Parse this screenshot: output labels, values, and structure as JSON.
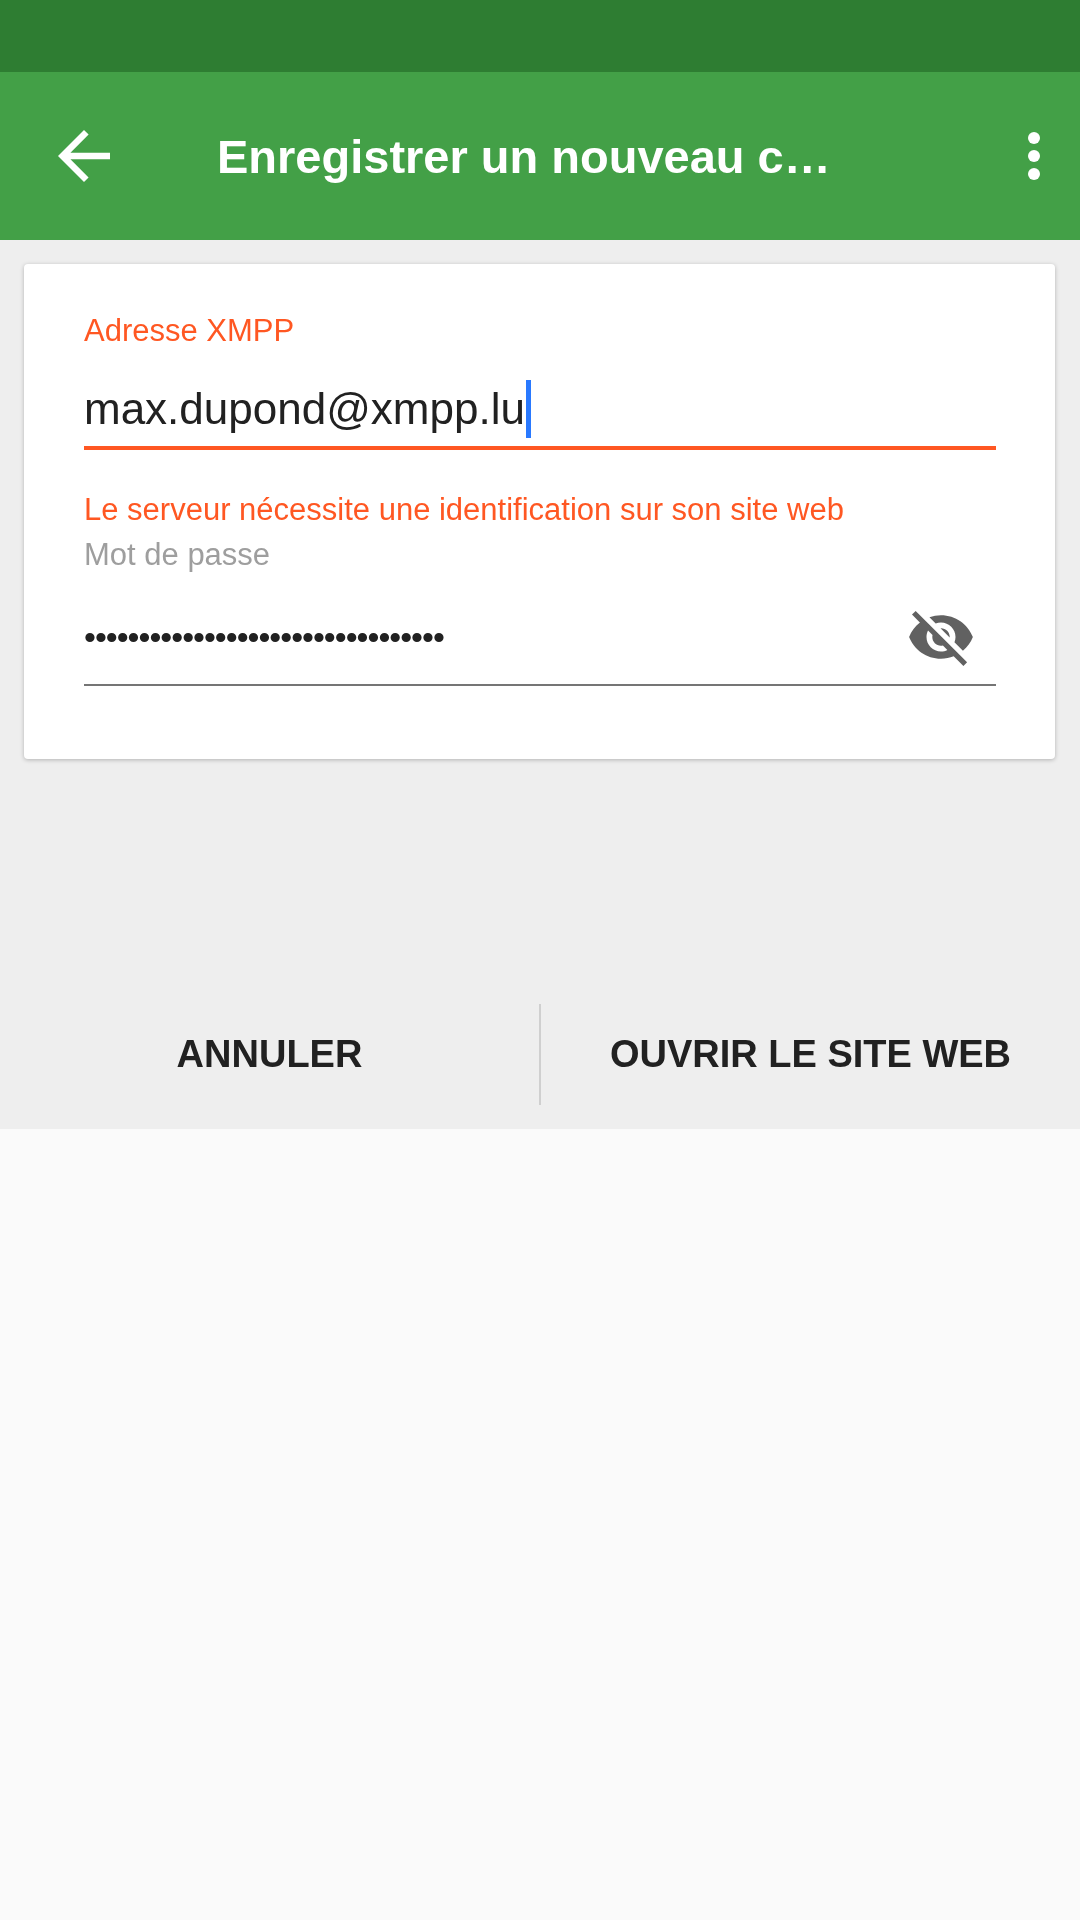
{
  "app_bar": {
    "title": "Enregistrer un nouveau c…"
  },
  "form": {
    "fields": [
      {
        "kind": "text",
        "label": "Adresse XMPP",
        "value": "max.dupond@xmpp.lu",
        "focused": true,
        "error": "Le serveur nécessite une identification sur son site web"
      },
      {
        "kind": "password",
        "label": "Mot de passe",
        "value": "•••••••••••••••••••••••••••••••••",
        "focused": false
      }
    ]
  },
  "buttons": [
    {
      "label": "ANNULER"
    },
    {
      "label": "OUVRIR LE SITE WEB"
    }
  ]
}
